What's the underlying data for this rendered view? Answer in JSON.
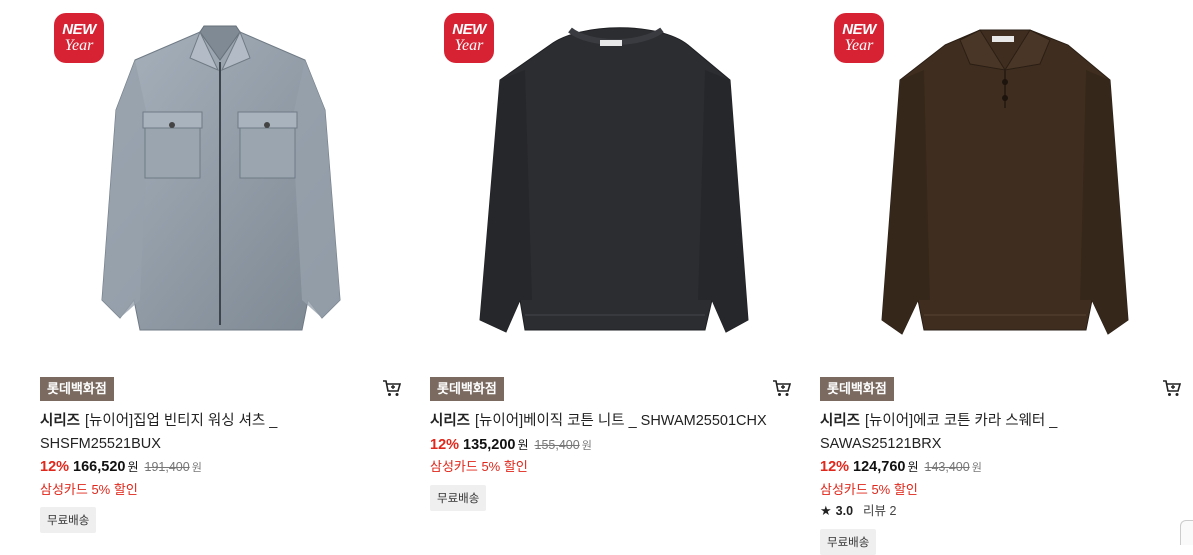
{
  "badge": {
    "line1": "NEW",
    "line2": "Year"
  },
  "products": [
    {
      "store": "롯데백화점",
      "brand": "시리즈",
      "name": "[뉴이어]집업 빈티지 워싱 셔츠 _ SHSFM25521BUX",
      "discount_rate": "12%",
      "price": "166,520",
      "price_unit": "원",
      "original_price": "191,400",
      "original_unit": "원",
      "card_discount": "삼성카드 5% 할인",
      "shipping": "무료배송",
      "image_color": "#8f9aa6"
    },
    {
      "store": "롯데백화점",
      "brand": "시리즈",
      "name": "[뉴이어]베이직 코튼 니트 _ SHWAM25501CHX",
      "discount_rate": "12%",
      "price": "135,200",
      "price_unit": "원",
      "original_price": "155,400",
      "original_unit": "원",
      "card_discount": "삼성카드 5% 할인",
      "shipping": "무료배송",
      "image_color": "#2c2d31"
    },
    {
      "store": "롯데백화점",
      "brand": "시리즈",
      "name": "[뉴이어]에코 코튼 카라 스웨터 _ SAWAS25121BRX",
      "discount_rate": "12%",
      "price": "124,760",
      "price_unit": "원",
      "original_price": "143,400",
      "original_unit": "원",
      "card_discount": "삼성카드 5% 할인",
      "rating": "3.0",
      "reviews": "리뷰 2",
      "shipping": "무료배송",
      "image_color": "#3f2e20"
    }
  ],
  "colors": {
    "badge": "#d62233",
    "store_tag": "#7a6a60",
    "discount": "#e0271b"
  }
}
